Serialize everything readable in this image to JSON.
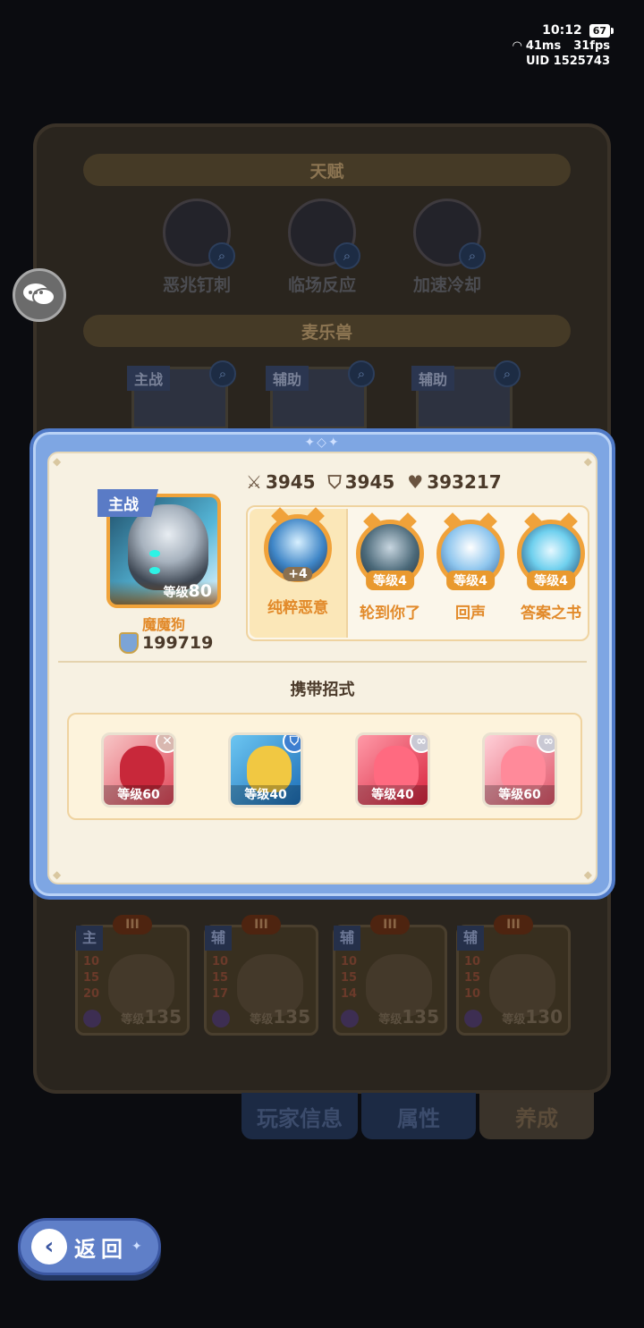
{
  "status": {
    "time": "10:12",
    "battery": "67",
    "latency": "41ms",
    "fps": "31fps",
    "uid_label": "UID",
    "uid": "1525743"
  },
  "background": {
    "talent_header": "天赋",
    "talents": [
      {
        "name": "恶兆钉刺",
        "icon": "talent-spike-icon"
      },
      {
        "name": "临场反应",
        "icon": "talent-reaction-icon"
      },
      {
        "name": "加速冷却",
        "icon": "talent-cooldown-icon"
      }
    ],
    "monster_header": "麦乐兽",
    "monsters": [
      {
        "role": "主战"
      },
      {
        "role": "辅助"
      },
      {
        "role": "辅助"
      }
    ],
    "pets": [
      {
        "role": "主",
        "rank": "III",
        "stats": [
          "10",
          "15",
          "20"
        ],
        "level_label": "等级",
        "level": "135"
      },
      {
        "role": "辅",
        "rank": "III",
        "stats": [
          "10",
          "15",
          "17"
        ],
        "level_label": "等级",
        "level": "135"
      },
      {
        "role": "辅",
        "rank": "III",
        "stats": [
          "10",
          "15",
          "14"
        ],
        "level_label": "等级",
        "level": "135"
      },
      {
        "role": "辅",
        "rank": "III",
        "stats": [
          "10",
          "15",
          "10"
        ],
        "level_label": "等级",
        "level": "130"
      }
    ],
    "tabs": [
      "玩家信息",
      "属性",
      "养成"
    ]
  },
  "popup": {
    "main_tag": "主战",
    "level_label": "等级",
    "level": "80",
    "name": "魔魔狗",
    "power": "199719",
    "stats": {
      "attack": "3945",
      "defense": "3945",
      "hp": "393217"
    },
    "skills": [
      {
        "name": "纯粹恶意",
        "badge": "+4",
        "icon": "skill-malice-icon"
      },
      {
        "name": "轮到你了",
        "badge": "等级4",
        "icon": "skill-turn-icon"
      },
      {
        "name": "回声",
        "badge": "等级4",
        "icon": "skill-echo-icon"
      },
      {
        "name": "答案之书",
        "badge": "等级4",
        "icon": "skill-answerbook-icon"
      }
    ],
    "moves_title": "携带招式",
    "moves": [
      {
        "level": "等级60",
        "color": "#e0485a",
        "badge_color": "#d9b8b0"
      },
      {
        "level": "等级40",
        "color": "#2d8ed8",
        "badge_color": "#3d7fd0"
      },
      {
        "level": "等级40",
        "color": "#e2465e",
        "badge_color": "#c9c9d4"
      },
      {
        "level": "等级60",
        "color": "#e66a7a",
        "badge_color": "#c9c9d4"
      }
    ]
  },
  "back_button": "返回"
}
